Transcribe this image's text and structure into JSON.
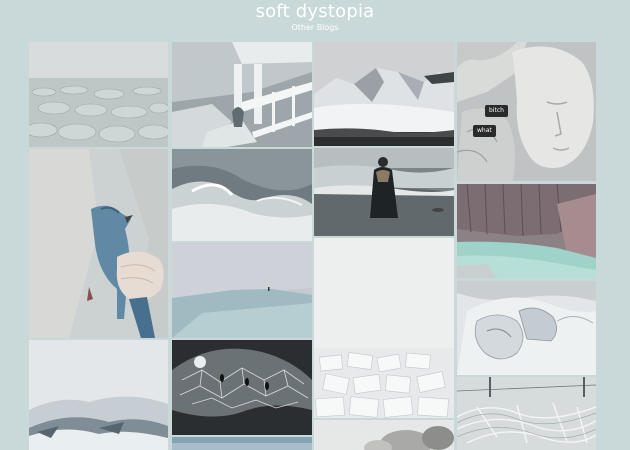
{
  "header": {
    "title": "soft dystopia",
    "link_label": "Other Blogs"
  },
  "posts": [
    {
      "id": "frozen-sea",
      "tags": []
    },
    {
      "id": "icy-pier",
      "tags": []
    },
    {
      "id": "snowy-mountain",
      "tags": []
    },
    {
      "id": "statue-head",
      "tags": [
        "bitch",
        "what"
      ]
    },
    {
      "id": "bird-in-hands",
      "tags": []
    },
    {
      "id": "ocean-wave",
      "tags": []
    },
    {
      "id": "woman-on-beach",
      "tags": []
    },
    {
      "id": "glacier-lake",
      "tags": []
    },
    {
      "id": "snow-slope",
      "tags": []
    },
    {
      "id": "white-blank",
      "tags": []
    },
    {
      "id": "ice-cave-lights",
      "tags": []
    },
    {
      "id": "paper-tiles",
      "tags": []
    },
    {
      "id": "snowy-hills",
      "tags": []
    },
    {
      "id": "frosted-branches",
      "tags": []
    }
  ]
}
